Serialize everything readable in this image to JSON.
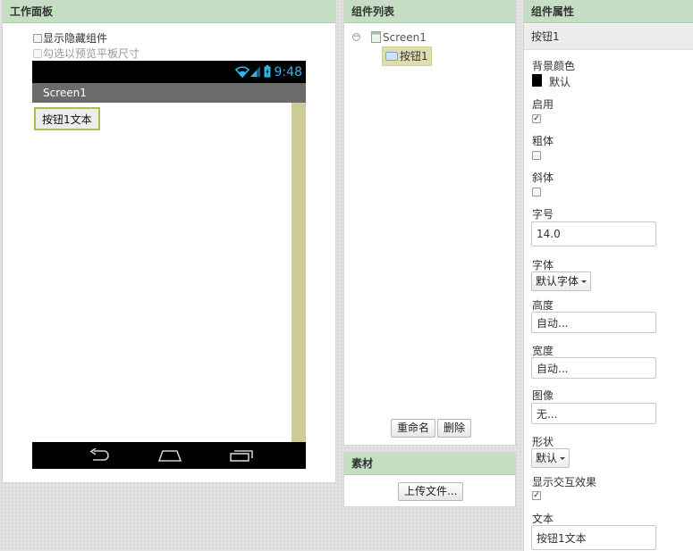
{
  "viewer": {
    "title": "工作面板",
    "show_hidden": "显示隐藏组件",
    "tablet_preview": "勾选以预览平板尺寸",
    "phone": {
      "time": "9:48",
      "screen_title": "Screen1",
      "button_text": "按钮1文本",
      "scroll_color": "#cccc9b",
      "button_border_color": "#a5c24c"
    }
  },
  "components": {
    "title": "组件列表",
    "tree": {
      "screen": "Screen1",
      "child": "按钮1"
    },
    "rename_label": "重命名",
    "delete_label": "删除"
  },
  "media": {
    "title": "素材",
    "upload_label": "上传文件..."
  },
  "properties": {
    "title": "组件属性",
    "component_name": "按钮1",
    "background_color": {
      "label": "背景颜色",
      "value": "默认",
      "color": "#000000"
    },
    "enabled": {
      "label": "启用",
      "checked": true
    },
    "bold": {
      "label": "粗体",
      "checked": false
    },
    "italic": {
      "label": "斜体",
      "checked": false
    },
    "font_size": {
      "label": "字号",
      "value": "14.0"
    },
    "font_family": {
      "label": "字体",
      "value": "默认字体"
    },
    "height": {
      "label": "高度",
      "value": "自动..."
    },
    "width": {
      "label": "宽度",
      "value": "自动..."
    },
    "image": {
      "label": "图像",
      "value": "无..."
    },
    "shape": {
      "label": "形状",
      "value": "默认"
    },
    "show_feedback": {
      "label": "显示交互效果",
      "checked": true
    },
    "text": {
      "label": "文本",
      "value": "按钮1文本"
    }
  },
  "theme": {
    "header_green": "#c4dec2",
    "selection": "#dedcb0",
    "android_blue": "#33b5e5"
  }
}
